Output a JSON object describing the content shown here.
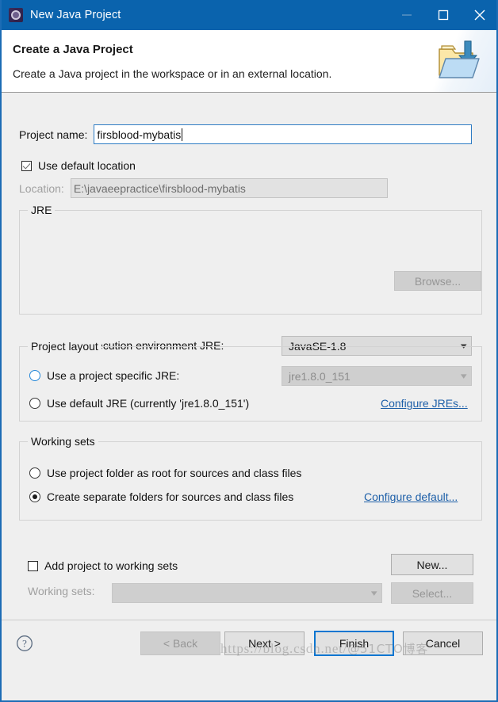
{
  "window": {
    "title": "New Java Project",
    "icon": "eclipse-gear-icon",
    "minimize_label": "—",
    "maximize_label": "□",
    "close_label": "✕"
  },
  "banner": {
    "title": "Create a Java Project",
    "subtitle": "Create a Java project in the workspace or in an external location.",
    "icon": "folder-with-arrow-icon"
  },
  "form": {
    "project_name_label": "Project name:",
    "project_name_value": "firsblood-mybatis",
    "use_default_location_label": "Use default location",
    "use_default_location_checked": true,
    "location_label": "Location:",
    "location_value": "E:\\javaeepractice\\firsblood-mybatis",
    "browse_label": "Browse..."
  },
  "jre": {
    "group_title": "JRE",
    "option_exec_env_label": "Use an execution environment JRE:",
    "option_exec_env_selected": true,
    "exec_env_value": "JavaSE-1.8",
    "option_project_specific_label": "Use a project specific JRE:",
    "option_project_specific_selected": false,
    "project_specific_value": "jre1.8.0_151",
    "option_default_jre_label": "Use default JRE (currently 'jre1.8.0_151')",
    "option_default_jre_selected": false,
    "configure_jres_link": "Configure JREs..."
  },
  "project_layout": {
    "group_title": "Project layout",
    "option_root_label": "Use project folder as root for sources and class files",
    "option_root_selected": false,
    "option_separate_label": "Create separate folders for sources and class files",
    "option_separate_selected": true,
    "configure_default_link": "Configure default..."
  },
  "working_sets": {
    "group_title": "Working sets",
    "add_to_working_sets_label": "Add project to working sets",
    "add_to_working_sets_checked": false,
    "new_label": "New...",
    "working_sets_label": "Working sets:",
    "working_sets_value": "",
    "select_label": "Select..."
  },
  "footer": {
    "help_icon": "help-question-icon",
    "back_label": "< Back",
    "next_label": "Next >",
    "finish_label": "Finish",
    "cancel_label": "Cancel"
  },
  "watermark": {
    "url": "https://blog.csdn.net/",
    "tag": "@51CTO博客"
  },
  "colors": {
    "titlebar": "#0a63ad",
    "accent": "#0b76d1",
    "body": "#efefef",
    "link": "#1d5fa8"
  }
}
